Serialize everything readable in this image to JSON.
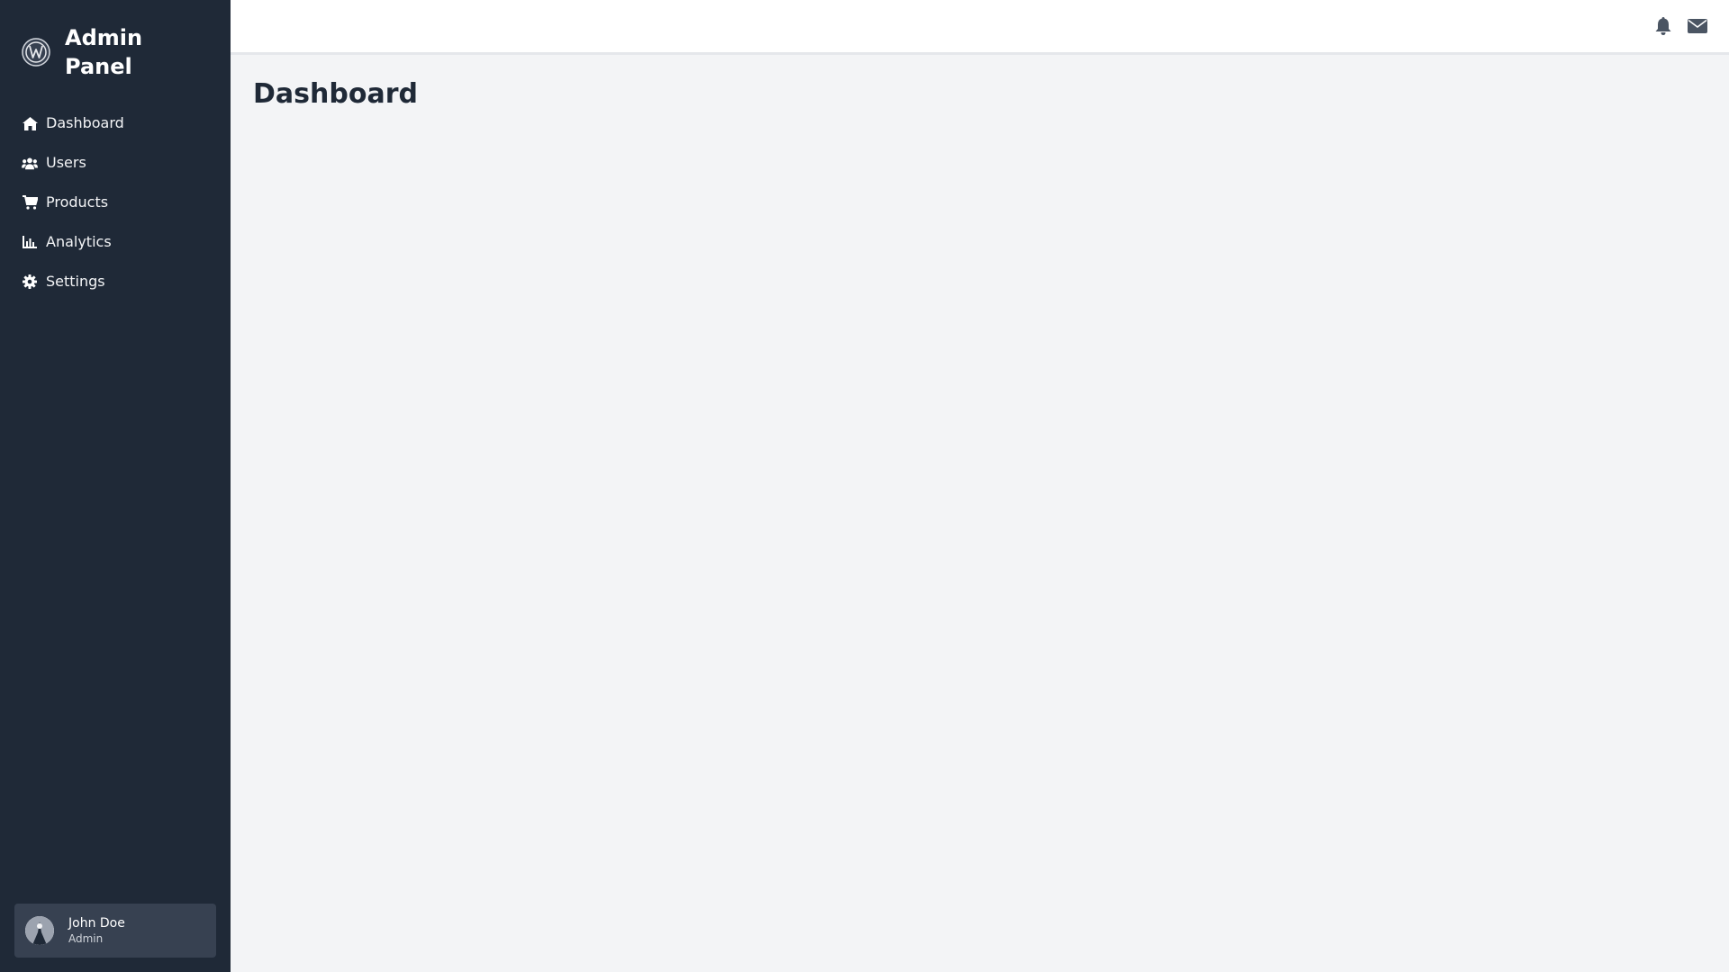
{
  "brand": {
    "title": "Admin Panel"
  },
  "sidebar": {
    "items": [
      {
        "label": "Dashboard",
        "icon": "home-icon"
      },
      {
        "label": "Users",
        "icon": "users-icon"
      },
      {
        "label": "Products",
        "icon": "cart-icon"
      },
      {
        "label": "Analytics",
        "icon": "chart-icon"
      },
      {
        "label": "Settings",
        "icon": "gear-icon"
      }
    ]
  },
  "user": {
    "name": "John Doe",
    "role": "Admin"
  },
  "topbar": {
    "icons": [
      "bell-icon",
      "envelope-icon"
    ]
  },
  "main": {
    "title": "Dashboard"
  },
  "colors": {
    "sidebar_bg": "#1f2937",
    "content_bg": "#f3f4f6",
    "user_card_bg": "#374151",
    "title_text": "#1f2937"
  }
}
